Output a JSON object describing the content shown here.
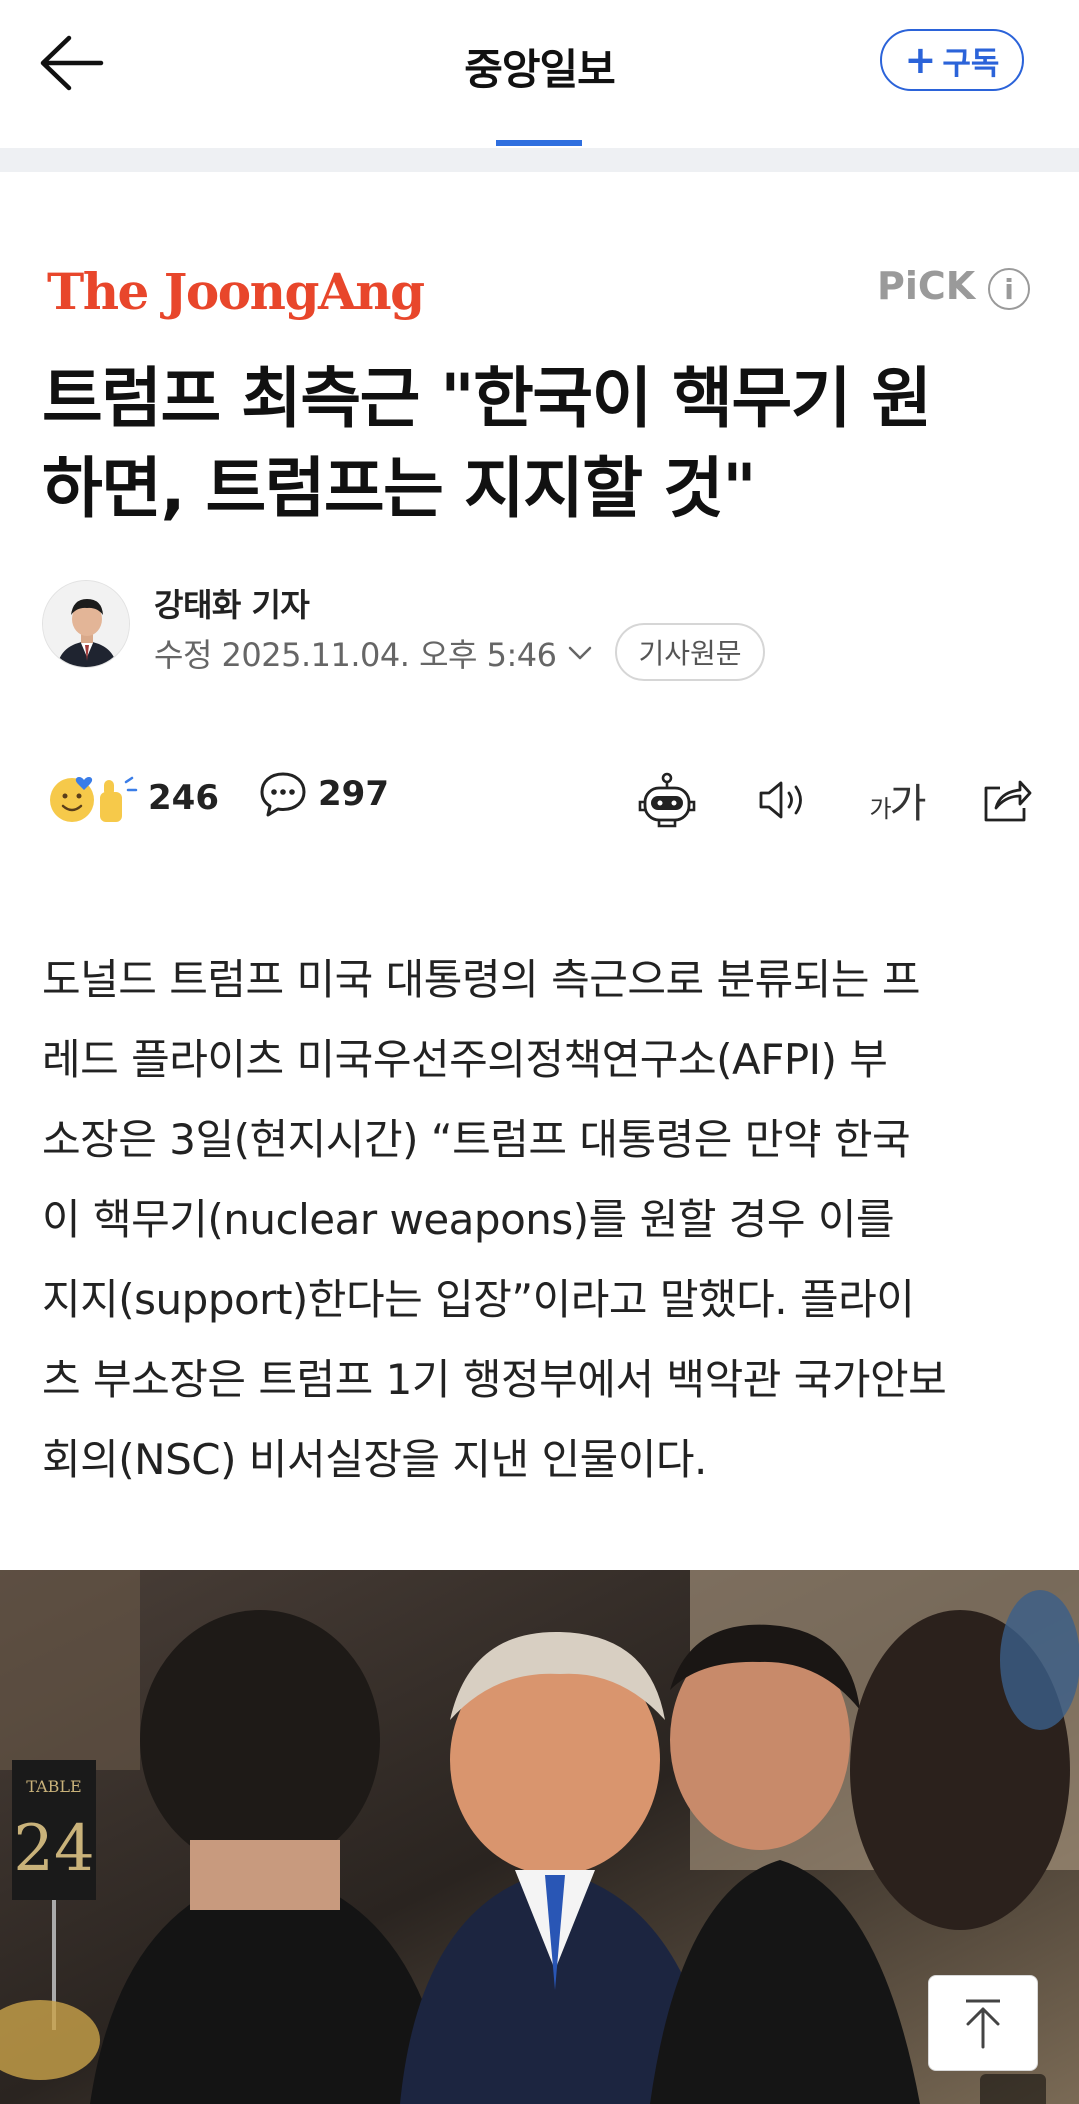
{
  "topbar": {
    "press_name": "중앙일보",
    "subscribe_label": "구독",
    "subscribe_plus": "+"
  },
  "article": {
    "source_logo": "The JoongAng",
    "pick_label": "PiCK",
    "pick_info": "i",
    "headline_line1": "트럼프 최측근 \"한국이 핵무기 원",
    "headline_line2": "하면, 트럼프는 지지할 것\"",
    "author": "강태화 기자",
    "date": "수정 2025.11.04. 오후 5:46",
    "original_label": "기사원문",
    "reaction_count": "246",
    "comment_count": "297",
    "fontsize_small": "가",
    "fontsize_large": "가",
    "body": [
      "도널드 트럼프 미국 대통령의 측근으로 분류되는 프",
      "레드 플라이츠 미국우선주의정책연구소(AFPI) 부",
      "소장은 3일(현지시간) “트럼프 대통령은 만약 한국",
      "이 핵무기(nuclear weapons)를 원할 경우 이를",
      "지지(support)한다는 입장”이라고 말했다. 플라이",
      "츠 부소장은 트럼프 1기 행정부에서 백악관 국가안보",
      "회의(NSC) 비서실장을 지낸 인물이다."
    ],
    "table_sign_label": "TABLE",
    "table_sign_number": "24"
  },
  "colors": {
    "accent_blue": "#2b63d9",
    "logo_orange": "#e8462b"
  },
  "icons": {
    "back": "arrow-left-icon",
    "reaction": "reaction-emoji-icon",
    "comment": "comment-bubble-icon",
    "summary_bot": "robot-summary-icon",
    "tts": "speaker-icon",
    "share": "share-icon",
    "scroll_top": "arrow-up-icon"
  }
}
